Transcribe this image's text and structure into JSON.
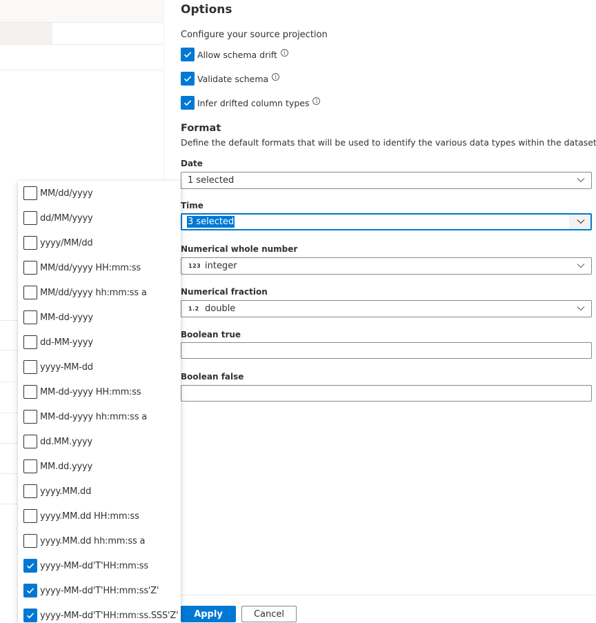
{
  "options": {
    "title": "Options",
    "subtitle": "Configure your source projection",
    "checkboxes": [
      {
        "label": "Allow schema drift",
        "checked": true
      },
      {
        "label": "Validate schema",
        "checked": true
      },
      {
        "label": "Infer drifted column types",
        "checked": true
      }
    ],
    "info_glyph": "i"
  },
  "format": {
    "title": "Format",
    "description": "Define the default formats that will be used to identify the various data types within the dataset",
    "date": {
      "label": "Date",
      "value": "1 selected"
    },
    "time": {
      "label": "Time",
      "value": "3 selected"
    },
    "whole": {
      "label": "Numerical whole number",
      "badge": "123",
      "value": "integer"
    },
    "fraction": {
      "label": "Numerical fraction",
      "badge": "1.2",
      "value": "double"
    },
    "bool_true": {
      "label": "Boolean true",
      "value": ""
    },
    "bool_false": {
      "label": "Boolean false",
      "value": ""
    }
  },
  "time_dropdown": {
    "items": [
      {
        "label": "MM/dd/yyyy",
        "checked": false
      },
      {
        "label": "dd/MM/yyyy",
        "checked": false
      },
      {
        "label": "yyyy/MM/dd",
        "checked": false
      },
      {
        "label": "MM/dd/yyyy HH:mm:ss",
        "checked": false
      },
      {
        "label": "MM/dd/yyyy hh:mm:ss a",
        "checked": false
      },
      {
        "label": "MM-dd-yyyy",
        "checked": false
      },
      {
        "label": "dd-MM-yyyy",
        "checked": false
      },
      {
        "label": "yyyy-MM-dd",
        "checked": false
      },
      {
        "label": "MM-dd-yyyy HH:mm:ss",
        "checked": false
      },
      {
        "label": "MM-dd-yyyy hh:mm:ss a",
        "checked": false
      },
      {
        "label": "dd.MM.yyyy",
        "checked": false
      },
      {
        "label": "MM.dd.yyyy",
        "checked": false
      },
      {
        "label": "yyyy.MM.dd",
        "checked": false
      },
      {
        "label": "yyyy.MM.dd HH:mm:ss",
        "checked": false
      },
      {
        "label": "yyyy.MM.dd hh:mm:ss a",
        "checked": false
      },
      {
        "label": "yyyy-MM-dd'T'HH:mm:ss",
        "checked": true
      },
      {
        "label": "yyyy-MM-dd'T'HH:mm:ss'Z'",
        "checked": true
      },
      {
        "label": "yyyy-MM-dd'T'HH:mm:ss.SSS'Z'",
        "checked": true
      }
    ]
  },
  "footer": {
    "apply_label": "Apply",
    "cancel_label": "Cancel"
  },
  "colors": {
    "accent": "#0078d4",
    "text": "#323130",
    "border": "#8a8886"
  }
}
